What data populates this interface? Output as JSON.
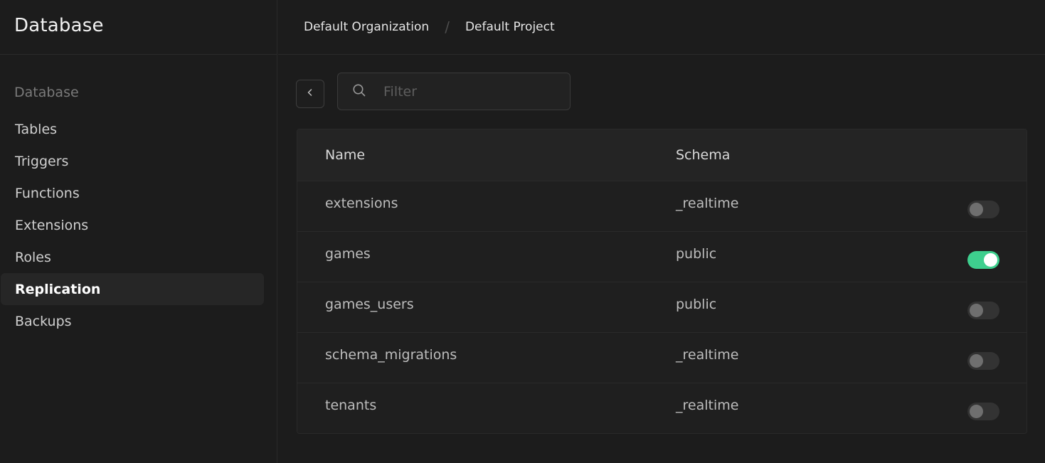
{
  "sidebar": {
    "title": "Database",
    "section_label": "Database",
    "items": [
      {
        "label": "Tables"
      },
      {
        "label": "Triggers"
      },
      {
        "label": "Functions"
      },
      {
        "label": "Extensions"
      },
      {
        "label": "Roles"
      },
      {
        "label": "Replication",
        "active": true
      },
      {
        "label": "Backups"
      }
    ]
  },
  "breadcrumb": {
    "organization": "Default Organization",
    "separator": "/",
    "project": "Default Project"
  },
  "toolbar": {
    "back_icon": "chevron-left-icon",
    "search_icon": "search-icon",
    "filter_placeholder": "Filter",
    "filter_value": ""
  },
  "table": {
    "columns": {
      "name": "Name",
      "schema": "Schema"
    },
    "rows": [
      {
        "name": "extensions",
        "schema": "_realtime",
        "enabled": false
      },
      {
        "name": "games",
        "schema": "public",
        "enabled": true
      },
      {
        "name": "games_users",
        "schema": "public",
        "enabled": false
      },
      {
        "name": "schema_migrations",
        "schema": "_realtime",
        "enabled": false
      },
      {
        "name": "tenants",
        "schema": "_realtime",
        "enabled": false
      }
    ]
  },
  "colors": {
    "background": "#1c1c1c",
    "accent": "#3ecf8e"
  }
}
